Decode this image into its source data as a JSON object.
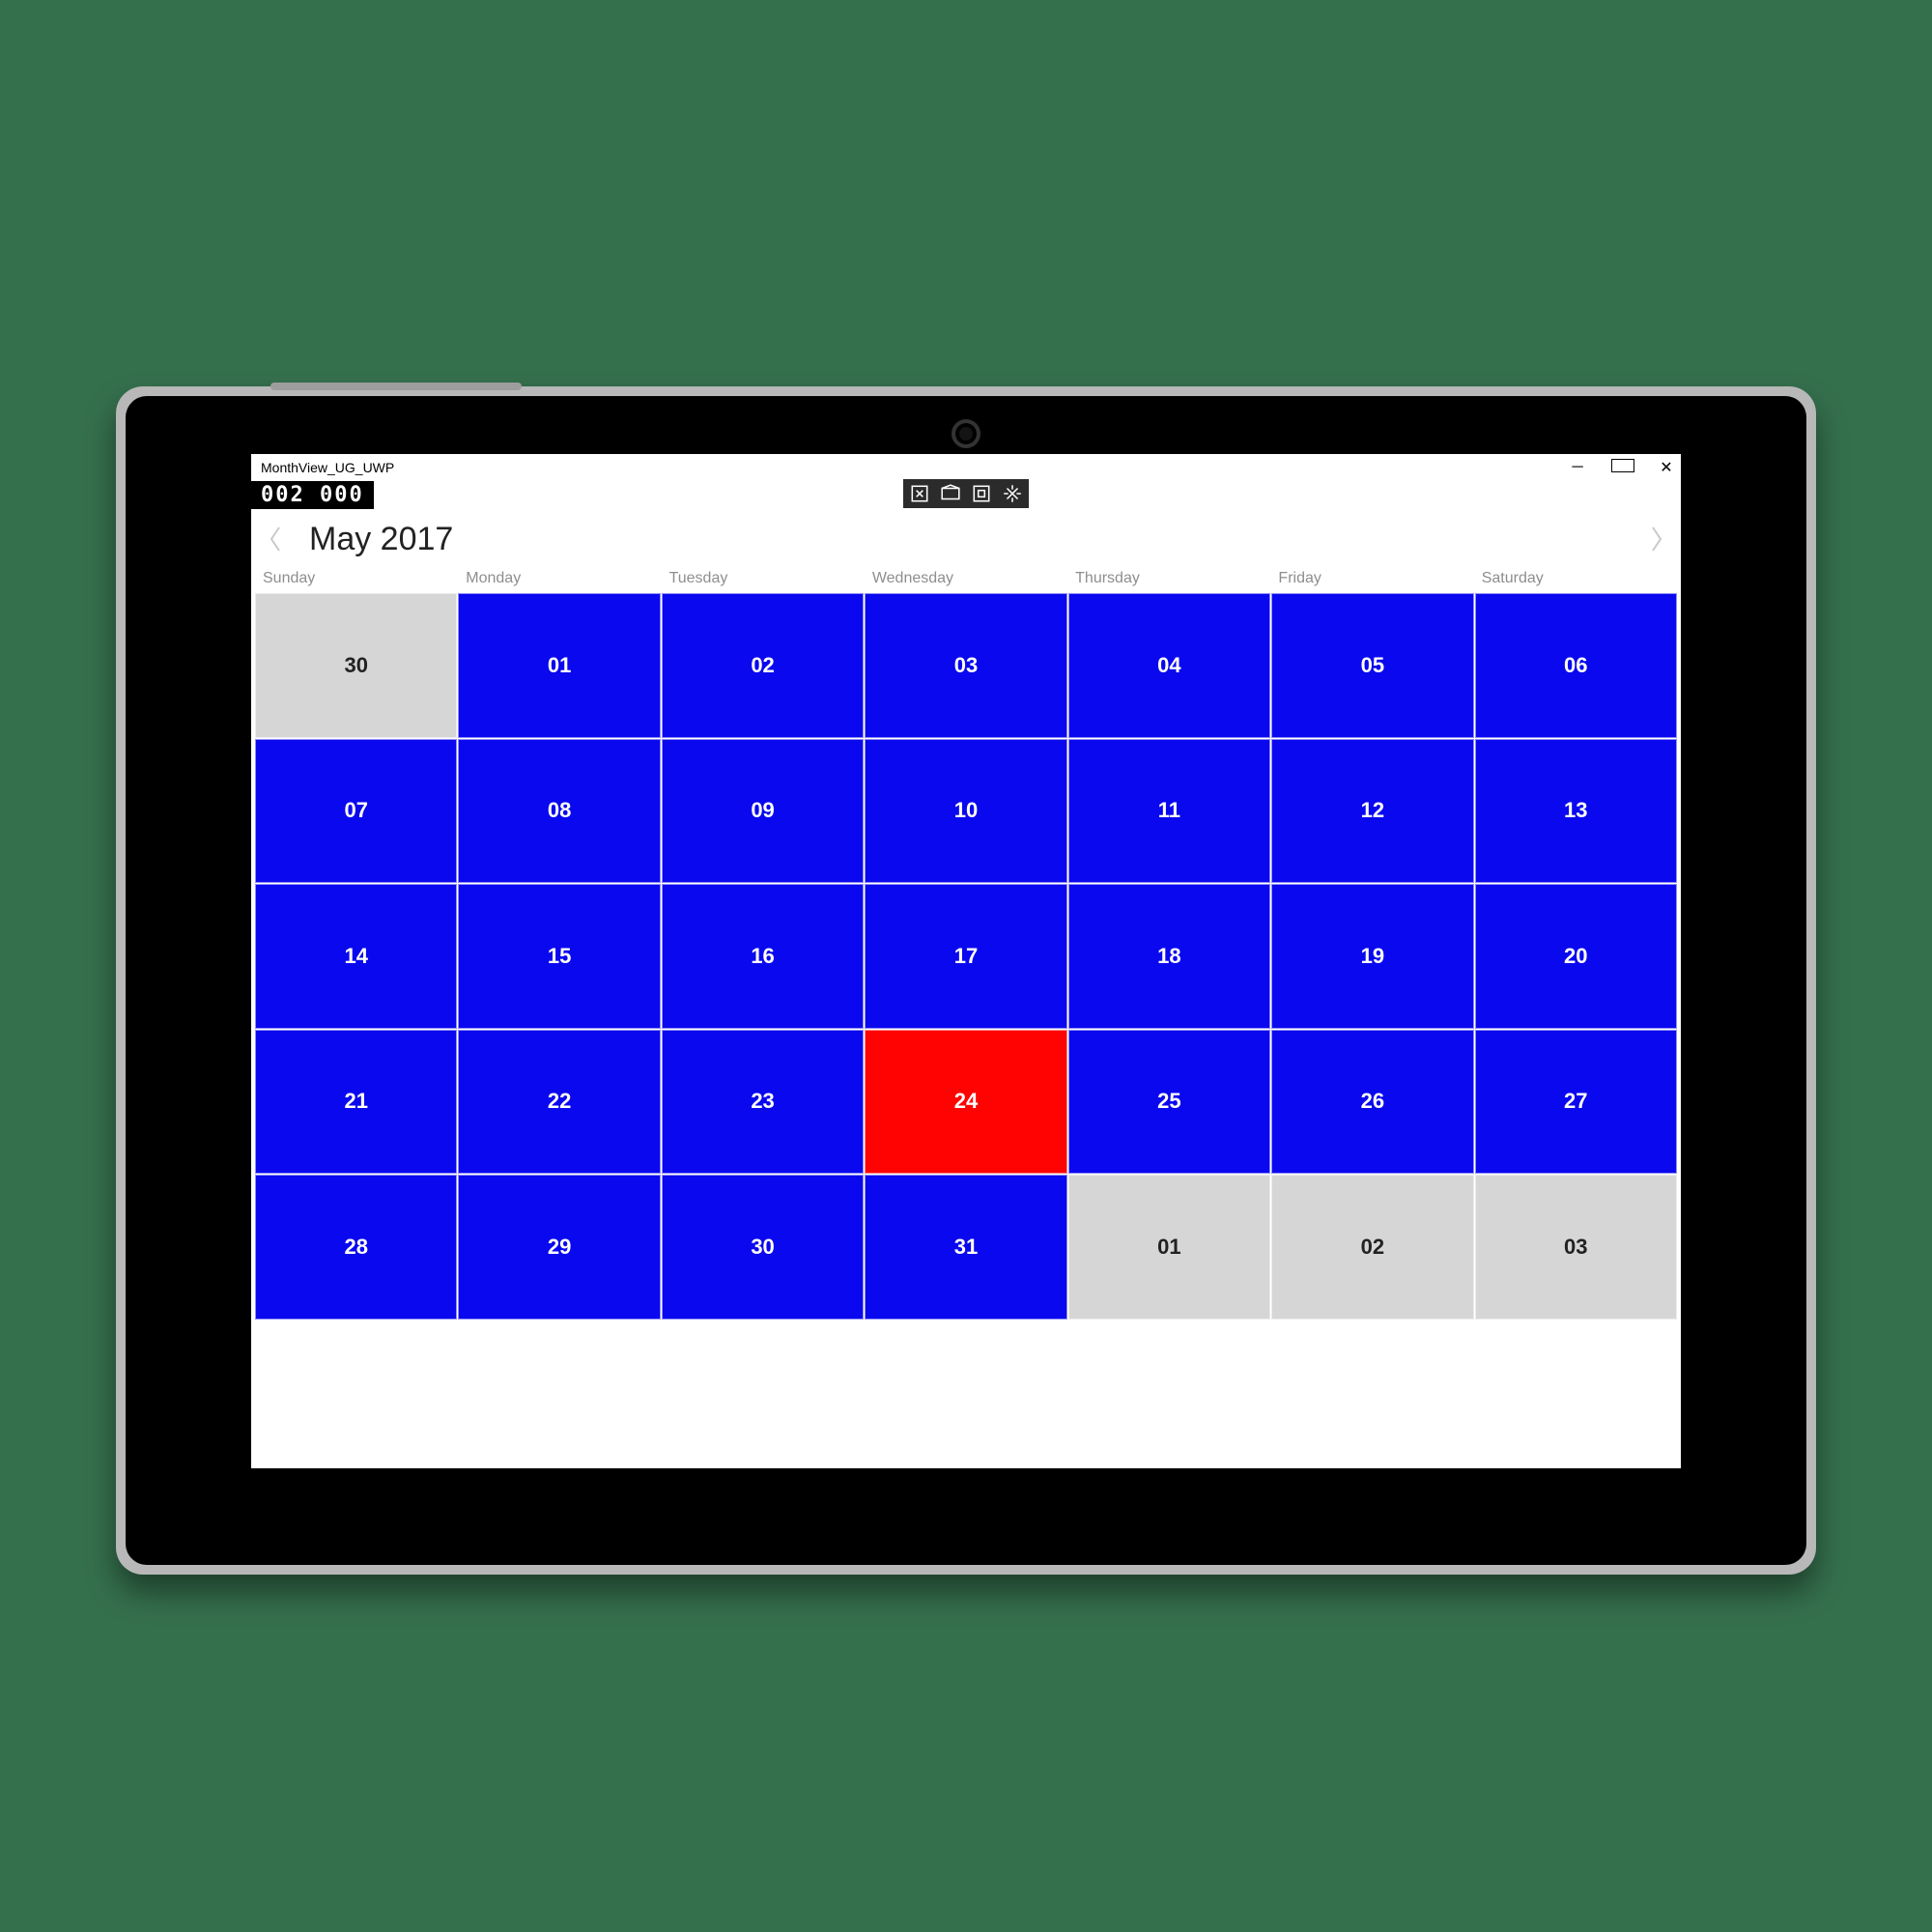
{
  "app": {
    "title": "MonthView_UG_UWP"
  },
  "fps": "002   000",
  "calendar": {
    "monthTitle": "May 2017",
    "weekdays": [
      "Sunday",
      "Monday",
      "Tuesday",
      "Wednesday",
      "Thursday",
      "Friday",
      "Saturday"
    ],
    "cells": [
      {
        "d": "30",
        "out": true
      },
      {
        "d": "01"
      },
      {
        "d": "02"
      },
      {
        "d": "03"
      },
      {
        "d": "04"
      },
      {
        "d": "05"
      },
      {
        "d": "06"
      },
      {
        "d": "07"
      },
      {
        "d": "08"
      },
      {
        "d": "09"
      },
      {
        "d": "10"
      },
      {
        "d": "11"
      },
      {
        "d": "12"
      },
      {
        "d": "13"
      },
      {
        "d": "14"
      },
      {
        "d": "15"
      },
      {
        "d": "16"
      },
      {
        "d": "17"
      },
      {
        "d": "18"
      },
      {
        "d": "19"
      },
      {
        "d": "20"
      },
      {
        "d": "21"
      },
      {
        "d": "22"
      },
      {
        "d": "23"
      },
      {
        "d": "24",
        "today": true
      },
      {
        "d": "25"
      },
      {
        "d": "26"
      },
      {
        "d": "27"
      },
      {
        "d": "28"
      },
      {
        "d": "29"
      },
      {
        "d": "30"
      },
      {
        "d": "31"
      },
      {
        "d": "01",
        "out": true
      },
      {
        "d": "02",
        "out": true
      },
      {
        "d": "03",
        "out": true
      }
    ]
  },
  "colors": {
    "dayBg": "#0a08ee",
    "todayBg": "#ff0303",
    "outBg": "#d6d6d6",
    "pageBg": "#35704d"
  }
}
